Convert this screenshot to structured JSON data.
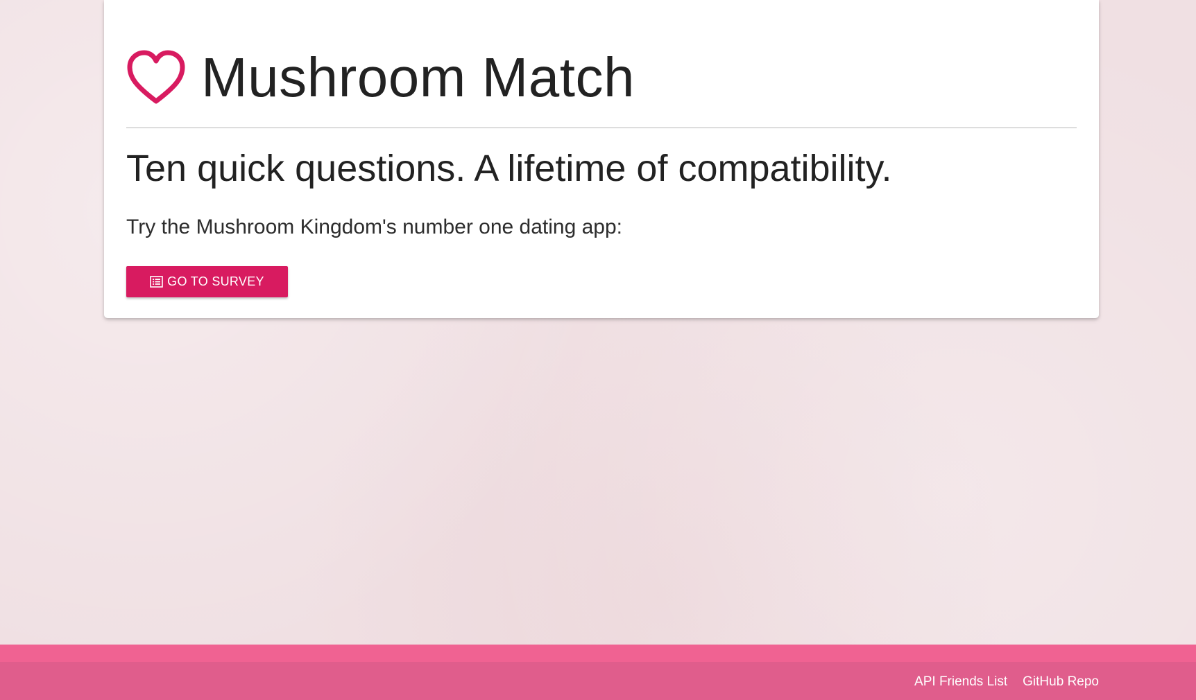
{
  "header": {
    "icon": "heart-outline-icon",
    "title": "Mushroom Match"
  },
  "main": {
    "tagline": "Ten quick questions. A lifetime of compatibility.",
    "lead": "Try the Mushroom Kingdom's number one dating app:",
    "survey_button": {
      "icon": "list-icon",
      "label": "GO TO SURVEY"
    }
  },
  "footer": {
    "links": [
      {
        "label": "API Friends List"
      },
      {
        "label": "GitHub Repo"
      }
    ]
  },
  "colors": {
    "accent": "#d81b60",
    "page_background": "#f0e0e3",
    "footer_top": "#f06292",
    "footer_bottom": "#e05d8c"
  }
}
